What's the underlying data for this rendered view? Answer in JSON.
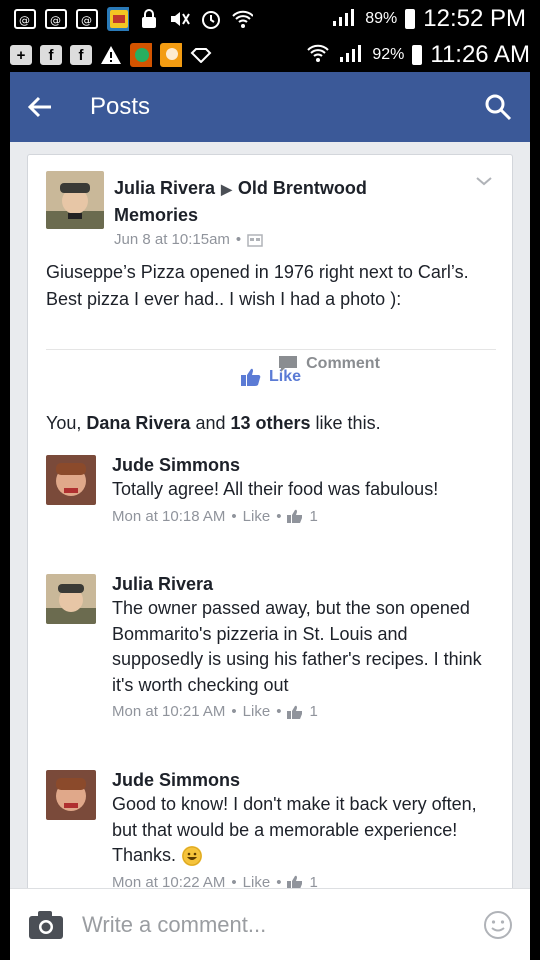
{
  "status_bar_1": {
    "time": "12:52 PM",
    "battery": "89%"
  },
  "status_bar_2": {
    "time": "11:26 AM",
    "battery": "92%"
  },
  "app_bar": {
    "title": "Posts"
  },
  "post": {
    "author": "Julia Rivera",
    "group": "Old Brentwood Memories",
    "timestamp": "Jun 8 at 10:15am",
    "separator": "•",
    "text": "Giuseppe’s Pizza opened in 1976 right next to Carl’s.  Best pizza I ever had.. I wish I had a photo ):",
    "like_label": "Like",
    "comment_label": "Comment"
  },
  "likes": {
    "prefix": "You, ",
    "name": "Dana Rivera",
    "middle": " and ",
    "others": "13 others",
    "suffix": " like this."
  },
  "comments": [
    {
      "name": "Jude Simmons",
      "text": "Totally agree!  All their food was fabulous!",
      "time": "Mon at 10:18 AM",
      "like_label": "Like",
      "like_count": "1"
    },
    {
      "name": "Julia Rivera",
      "text": "The owner passed away, but the son opened Bommarito's pizzeria in St. Louis and supposedly is using his father's recipes.  I think it's worth checking out",
      "time": "Mon at 10:21 AM",
      "like_label": "Like",
      "like_count": "1"
    },
    {
      "name": "Jude Simmons",
      "text": "Good to know!  I don't make it back very often, but that would be a memorable experience!  Thanks.",
      "time": "Mon at 10:22 AM",
      "like_label": "Like",
      "like_count": "1"
    }
  ],
  "composer": {
    "placeholder": "Write a comment..."
  },
  "colors": {
    "facebook_blue": "#3b5998",
    "like_blue": "#5b7bd5",
    "meta_gray": "#90949c"
  }
}
